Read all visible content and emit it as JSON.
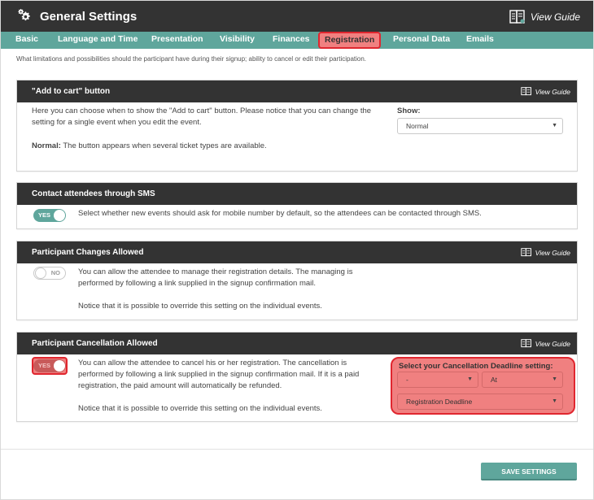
{
  "app": {
    "title": "General Settings",
    "view_guide": "View Guide"
  },
  "tabs": [
    {
      "label": "Basic"
    },
    {
      "label": "Language and Time"
    },
    {
      "label": "Presentation"
    },
    {
      "label": "Visibility"
    },
    {
      "label": "Finances"
    },
    {
      "label": "Registration",
      "active": true
    },
    {
      "label": "Personal Data"
    },
    {
      "label": "Emails"
    }
  ],
  "intro": "What limitations and possibilities should the participant have during their signup; ability to cancel or edit their participation.",
  "add_to_cart": {
    "title": "\"Add to cart\" button",
    "view_guide": "View Guide",
    "line1": "Here you can choose when to show the \"Add to cart\" button. Please notice that you can change the",
    "line2": "setting for a single event when you edit the event.",
    "mode_label": "Normal:",
    "mode_desc": "The button appears when several ticket types are available.",
    "show_label": "Show:",
    "show_value": "Normal"
  },
  "sms": {
    "title": "Contact attendees through SMS",
    "toggle": "YES",
    "text": "Select whether new events should ask for mobile number by default, so the attendees can be contacted through SMS."
  },
  "changes": {
    "title": "Participant Changes Allowed",
    "view_guide": "View Guide",
    "toggle": "NO",
    "line1": "You can allow the attendee to manage their registration details. The managing is",
    "line2": "performed by following a link supplied in the signup confirmation mail.",
    "line3": "Notice that it is possible to override this setting on the individual events."
  },
  "cancellation": {
    "title": "Participant Cancellation Allowed",
    "view_guide": "View Guide",
    "toggle": "YES",
    "line1": "You can allow the attendee to cancel his or her registration. The cancellation is",
    "line2": "performed by following a link supplied in the signup confirmation mail. If it is a paid",
    "line3": "registration, the paid amount will automatically be refunded.",
    "line4": "Notice that it is possible to override this setting on the individual events.",
    "deadline_title": "Select your Cancellation Deadline setting:",
    "select1": "-",
    "select2": "At",
    "select3": "Registration Deadline"
  },
  "footer": {
    "save": "SAVE SETTINGS"
  },
  "colors": {
    "header": "#333333",
    "accent": "#5fa69c",
    "highlight": "#f08080",
    "highlight_border": "#e0262f"
  }
}
